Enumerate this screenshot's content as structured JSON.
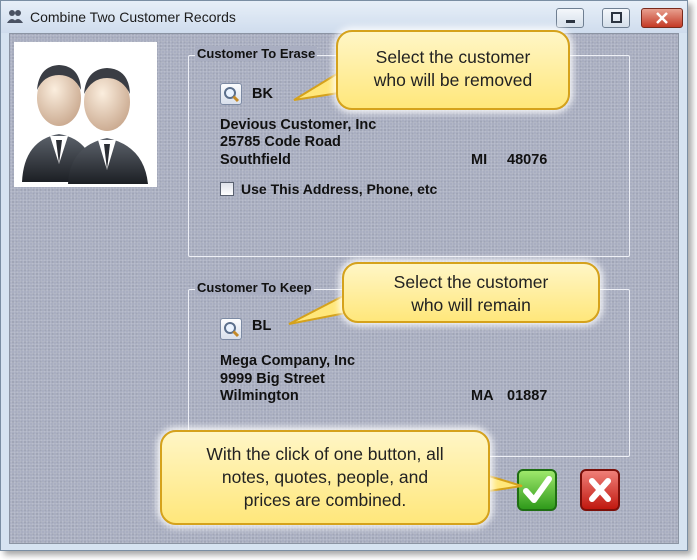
{
  "window": {
    "title": "Combine Two Customer Records"
  },
  "erase": {
    "legend": "Customer To Erase",
    "code": "BK",
    "name": "Devious Customer, Inc",
    "street": "25785 Code Road",
    "city": "Southfield",
    "state": "MI",
    "zip": "48076",
    "checkbox_label": "Use This Address, Phone, etc",
    "checkbox_checked": false
  },
  "keep": {
    "legend": "Customer To Keep",
    "code": "BL",
    "name": "Mega Company, Inc",
    "street": "9999 Big Street",
    "city": "Wilmington",
    "state": "MA",
    "zip": "01887"
  },
  "callouts": {
    "erase": [
      "Select the customer",
      "who will be removed"
    ],
    "keep": [
      "Select the customer",
      "who will remain"
    ],
    "combine": [
      "With the click of one button, all",
      "notes, quotes, people, and",
      "prices are combined."
    ]
  },
  "icons": {
    "app": "people-icon",
    "photo": "two-business-people-icon",
    "lookup": "magnifier-icon",
    "ok": "checkmark-icon",
    "cancel": "x-icon"
  },
  "colors": {
    "ok": "#3aa620",
    "cancel": "#d42015",
    "callout": "#ffe77b"
  }
}
